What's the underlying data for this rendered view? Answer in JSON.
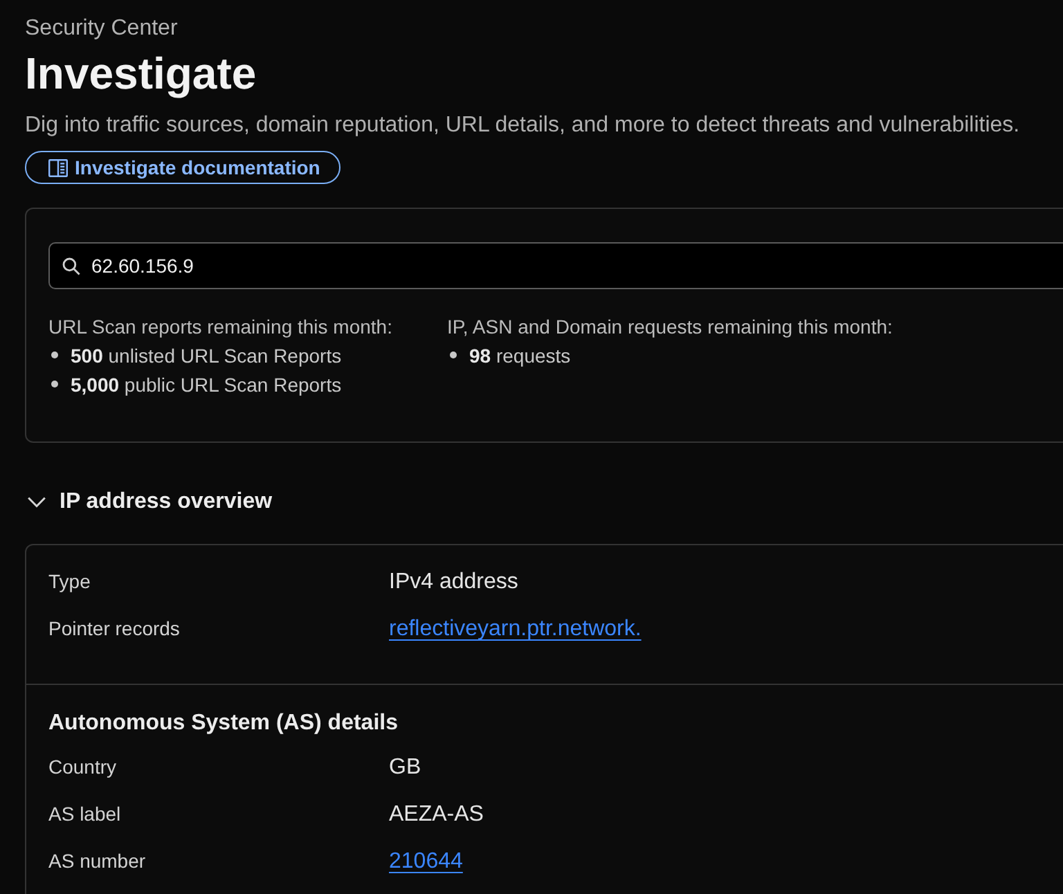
{
  "header": {
    "breadcrumb": "Security Center",
    "title": "Investigate",
    "description": "Dig into traffic sources, domain reputation, URL details, and more to detect threats and vulnerabilities.",
    "docs_button": "Investigate documentation"
  },
  "search": {
    "value": "62.60.156.9"
  },
  "quotas": [
    {
      "heading": "URL Scan reports remaining this month:",
      "items": [
        "**500** unlisted URL Scan Reports",
        "**5,000** public URL Scan Reports"
      ]
    },
    {
      "heading": "IP, ASN and Domain requests remaining this month:",
      "items": [
        "**98** requests"
      ]
    }
  ],
  "overview": {
    "title": "IP address overview",
    "expanded": true,
    "sections": [
      {
        "rows": [
          {
            "label": "Type",
            "value": "IPv4 address",
            "kind": "text"
          },
          {
            "label": "Pointer records",
            "value": "reflectiveyarn.ptr.network.",
            "kind": "link"
          }
        ]
      },
      {
        "title": "Autonomous System (AS) details",
        "rows": [
          {
            "label": "Country",
            "value": "GB",
            "kind": "text"
          },
          {
            "label": "AS label",
            "value": "AEZA-AS",
            "kind": "text"
          },
          {
            "label": "AS number",
            "value": "210644",
            "kind": "link"
          }
        ]
      }
    ]
  }
}
